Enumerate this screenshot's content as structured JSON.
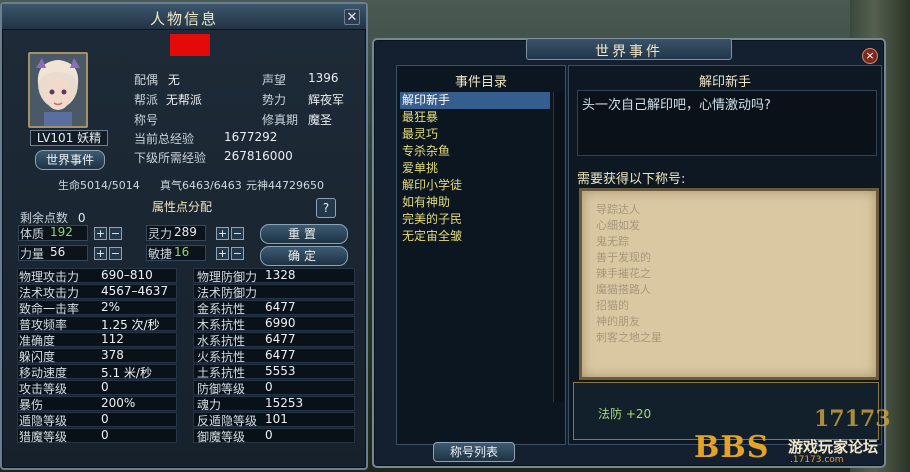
{
  "character_panel": {
    "title": "人物信息",
    "close_glyph": "✕",
    "level_label": "LV101 妖精",
    "world_event_button": "世界事件",
    "info": {
      "spouse_label": "配偶",
      "spouse_value": "无",
      "guild_label": "帮派",
      "guild_value": "无帮派",
      "title_label": "称号",
      "title_value": "",
      "total_exp_label": "当前总经验",
      "total_exp_value": "1677292",
      "next_exp_label": "下级所需经验",
      "next_exp_value": "267816000",
      "reputation_label": "声望",
      "reputation_value": "1396",
      "faction_label": "势力",
      "faction_value": "辉夜军",
      "realm_label": "修真期",
      "realm_value": "魔圣"
    },
    "vitals": {
      "hp": "生命5014/5014",
      "mp": "真气6463/6463",
      "spirit": "元神44729650"
    },
    "attributes": {
      "header": "属性点分配",
      "help_glyph": "?",
      "remaining_label": "剩余点数",
      "remaining_value": "0",
      "constitution_label": "体质",
      "constitution_value": "192",
      "strength_label": "力量",
      "strength_value": "56",
      "spirit_label": "灵力",
      "spirit_value": "289",
      "agility_label": "敏捷",
      "agility_value": "16",
      "plus": "+",
      "minus": "−",
      "reset_button": "重置",
      "confirm_button": "确定"
    },
    "stats": [
      {
        "l1": "物理攻击力",
        "v1": "690–810",
        "l2": "物理防御力",
        "v2": "1328"
      },
      {
        "l1": "法术攻击力",
        "v1": "4567–4637",
        "l2": "法术防御力",
        "v2": ""
      },
      {
        "l1": "致命一击率",
        "v1": "2%",
        "l2": "金系抗性",
        "v2": "6477"
      },
      {
        "l1": "普攻频率",
        "v1": "1.25 次/秒",
        "l2": "木系抗性",
        "v2": "6990"
      },
      {
        "l1": "准确度",
        "v1": "112",
        "l2": "水系抗性",
        "v2": "6477"
      },
      {
        "l1": "躲闪度",
        "v1": "378",
        "l2": "火系抗性",
        "v2": "6477"
      },
      {
        "l1": "移动速度",
        "v1": "5.1 米/秒",
        "l2": "土系抗性",
        "v2": "5553"
      },
      {
        "l1": "攻击等级",
        "v1": "0",
        "l2": "防御等级",
        "v2": "0"
      },
      {
        "l1": "暴伤",
        "v1": "200%",
        "l2": "魂力",
        "v2": "15253"
      },
      {
        "l1": "遁隐等级",
        "v1": "0",
        "l2": "反遁隐等级",
        "v2": "101"
      },
      {
        "l1": "猎魔等级",
        "v1": "0",
        "l2": "御魔等级",
        "v2": "0"
      }
    ]
  },
  "world_panel": {
    "title": "世界事件",
    "close_glyph": "×",
    "list_header": "事件目录",
    "events": [
      "解印新手",
      "最狂暴",
      "最灵巧",
      "专杀杂鱼",
      "爱单挑",
      "解印小学徒",
      "如有神助",
      "完美的子民",
      "无定宙全皱"
    ],
    "selected_index": 0,
    "title_list_button": "称号列表",
    "detail_header": "解印新手",
    "detail_description": "头一次自己解印吧，心情激动吗?",
    "requirement_label": "需要获得以下称号:",
    "required_titles": [
      "导踪达人",
      "心细如发",
      "鬼无踪",
      "善于发现的",
      "辣手摧花之",
      "魔猫搭路人",
      "招猫的",
      "神的朋友",
      "刺客之地之星"
    ],
    "reward_text": "法防 +20"
  },
  "watermark": {
    "bbs": "BBS",
    "site_cn": "游戏玩家论坛",
    "url": ".17173.com",
    "logo": "17173"
  },
  "colors": {
    "name_plate": "#e30a0a",
    "list_text": "#e6dc7a",
    "list_selected_bg": "#355d8e",
    "reward": "#a7d97a"
  }
}
